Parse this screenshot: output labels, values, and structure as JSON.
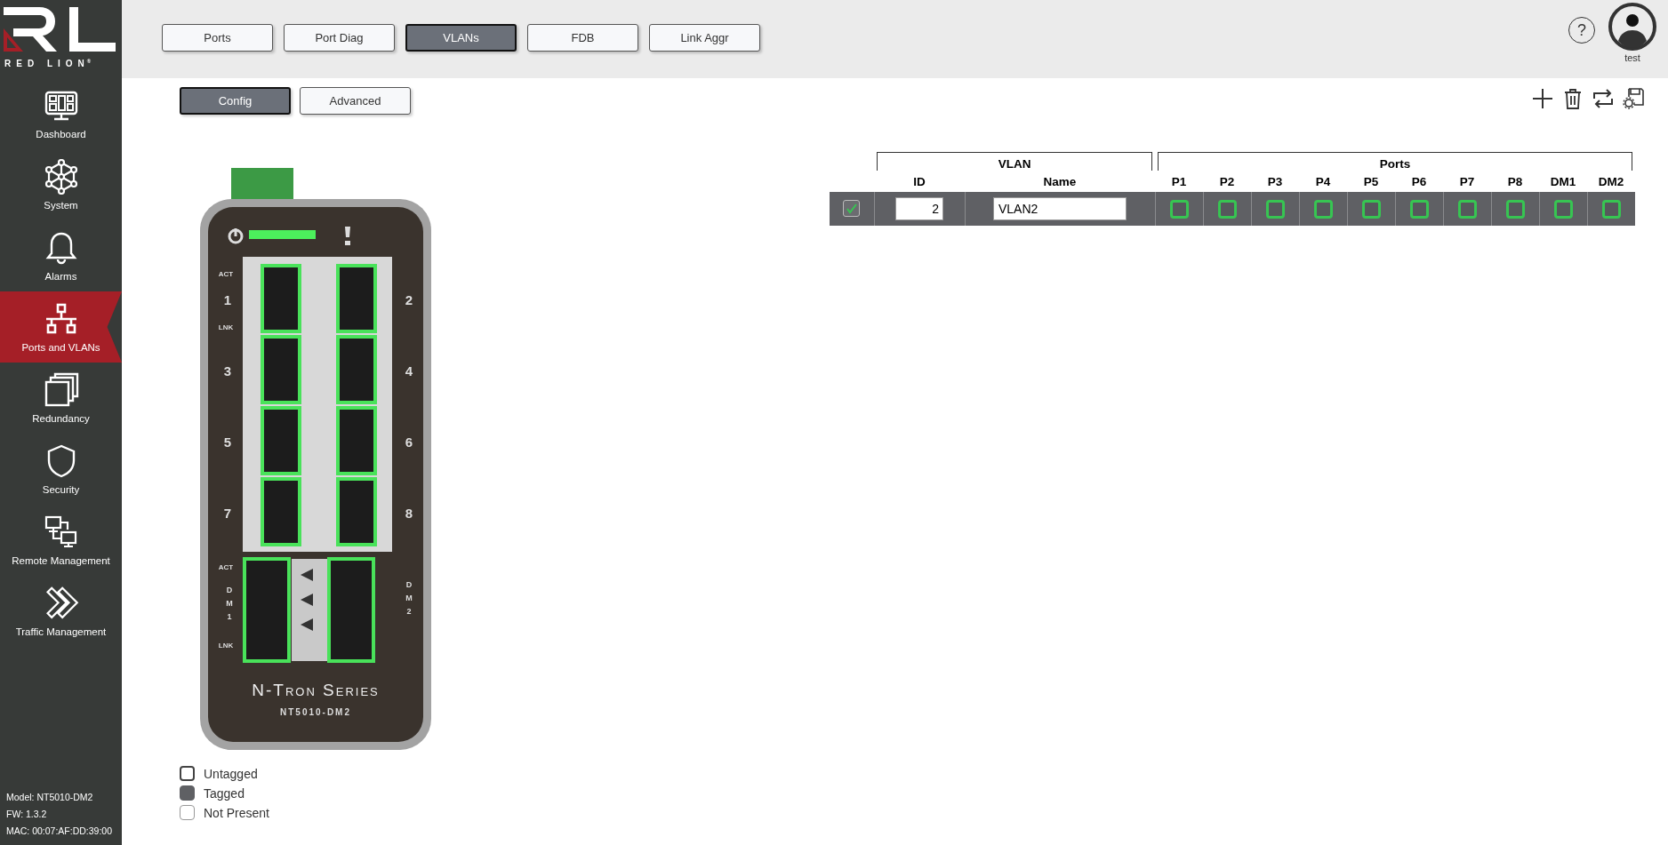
{
  "sidebar": {
    "logo": {
      "wordmark": "RED LION",
      "registered": "®"
    },
    "items": [
      {
        "label": "Dashboard",
        "selected": false
      },
      {
        "label": "System",
        "selected": false
      },
      {
        "label": "Alarms",
        "selected": false
      },
      {
        "label": "Ports and VLANs",
        "selected": true
      },
      {
        "label": "Redundancy",
        "selected": false
      },
      {
        "label": "Security",
        "selected": false
      },
      {
        "label": "Remote Management",
        "selected": false
      },
      {
        "label": "Traffic Management",
        "selected": false
      }
    ],
    "info": [
      "Model: NT5010-DM2",
      "FW: 1.3.2",
      "MAC: 00:07:AF:DD:39:00"
    ]
  },
  "tabs": [
    {
      "label": "Ports",
      "selected": false
    },
    {
      "label": "Port Diag",
      "selected": false
    },
    {
      "label": "VLANs",
      "selected": true
    },
    {
      "label": "FDB",
      "selected": false
    },
    {
      "label": "Link Aggr",
      "selected": false
    }
  ],
  "user": {
    "help": "?",
    "name": "test"
  },
  "subtabs": [
    {
      "label": "Config",
      "selected": true
    },
    {
      "label": "Advanced",
      "selected": false
    }
  ],
  "device": {
    "port_led_labels": [
      "ACT",
      "LNK"
    ],
    "dm_led_labels": [
      "ACT",
      "LNK"
    ],
    "ports": [
      {
        "label": "1",
        "highlighted": true
      },
      {
        "label": "2",
        "highlighted": true
      },
      {
        "label": "3",
        "highlighted": true
      },
      {
        "label": "4",
        "highlighted": true
      },
      {
        "label": "5",
        "highlighted": true
      },
      {
        "label": "6",
        "highlighted": true
      },
      {
        "label": "7",
        "highlighted": true
      },
      {
        "label": "8",
        "highlighted": true
      }
    ],
    "dm_ports": [
      {
        "label": "DM1",
        "highlighted": true
      },
      {
        "label": "DM2",
        "highlighted": true
      }
    ],
    "series": "N-Tron Series",
    "model": "NT5010-DM2"
  },
  "legend": [
    {
      "label": "Untagged",
      "kind": "untagged"
    },
    {
      "label": "Tagged",
      "kind": "tagged"
    },
    {
      "label": "Not Present",
      "kind": "not_present"
    }
  ],
  "table": {
    "groups": [
      "VLAN",
      "Ports"
    ],
    "columns": [
      "ID",
      "Name"
    ],
    "port_columns": [
      "P1",
      "P2",
      "P3",
      "P4",
      "P5",
      "P6",
      "P7",
      "P8",
      "DM1",
      "DM2"
    ],
    "rows": [
      {
        "checked": true,
        "id": "2",
        "name": "VLAN2",
        "ports": [
          {
            "highlighted": true
          },
          {
            "highlighted": true
          },
          {
            "highlighted": true
          },
          {
            "highlighted": true
          },
          {
            "highlighted": true
          },
          {
            "highlighted": true
          },
          {
            "highlighted": true
          },
          {
            "highlighted": true
          },
          {
            "highlighted": true
          },
          {
            "highlighted": true
          }
        ]
      }
    ]
  }
}
